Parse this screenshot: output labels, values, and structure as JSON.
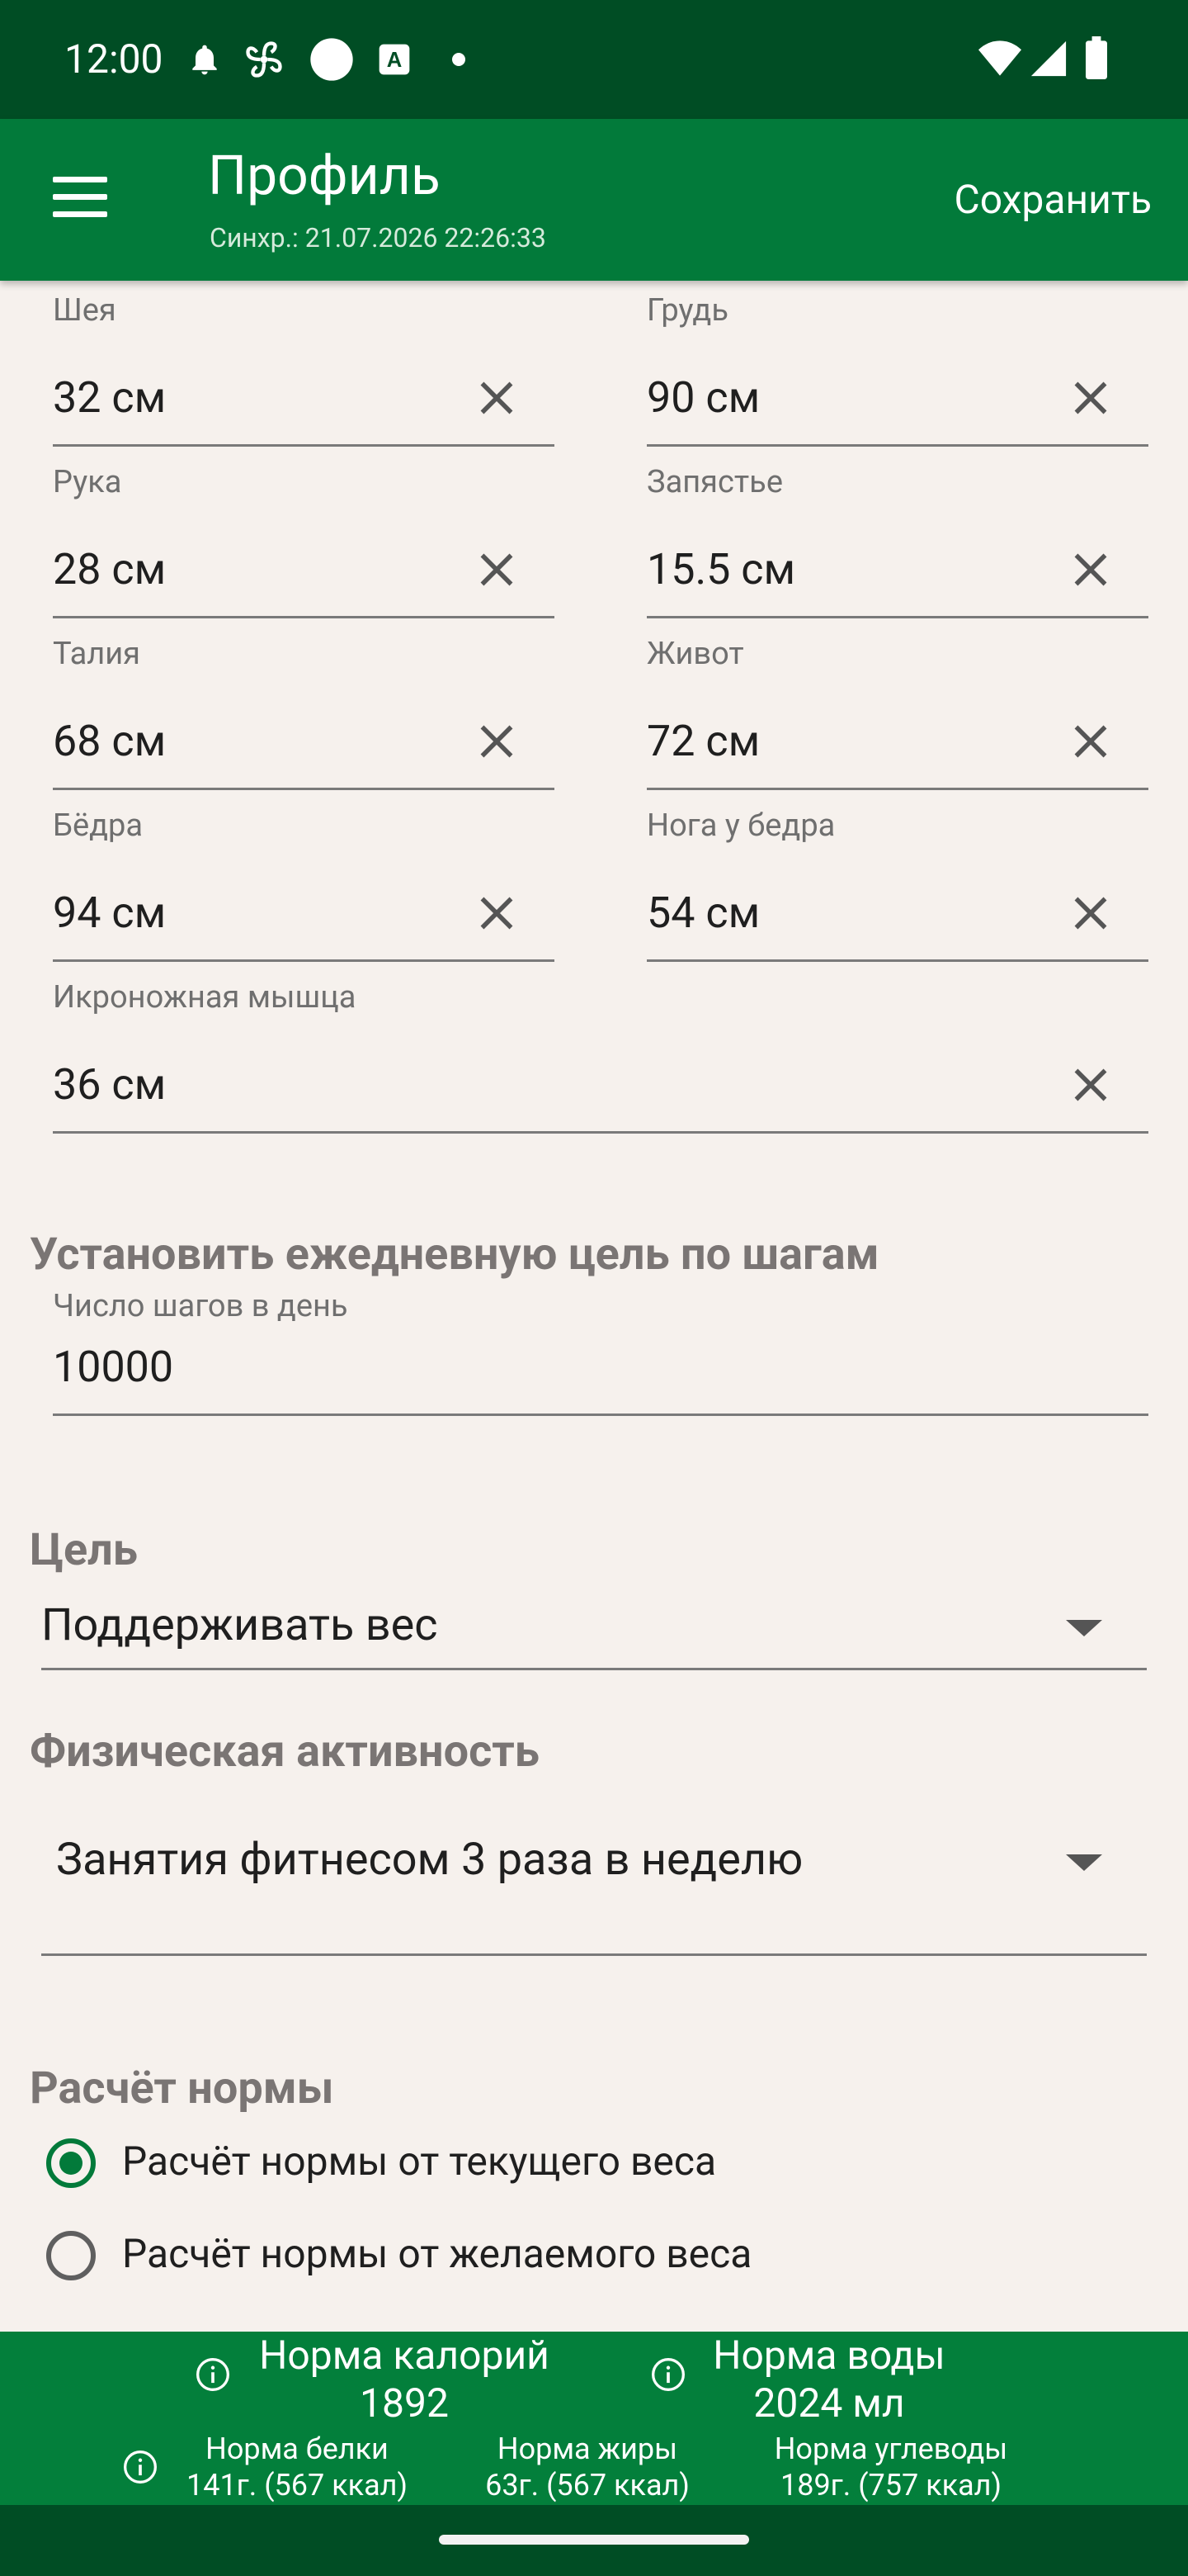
{
  "status_bar": {
    "time": "12:00",
    "icons": [
      "bell-icon",
      "fan-icon",
      "circle-icon",
      "a-box-icon",
      "dot-icon",
      "wifi-icon",
      "signal-icon",
      "battery-icon"
    ]
  },
  "app_bar": {
    "title": "Профиль",
    "subtitle": "Синхр.: 21.07.2026 22:26:33",
    "save_label": "Сохранить",
    "background_color": "#027a3a"
  },
  "measurements": [
    {
      "label": "Шея",
      "value": "32 см"
    },
    {
      "label": "Грудь",
      "value": "90 см"
    },
    {
      "label": "Рука",
      "value": "28 см"
    },
    {
      "label": "Запястье",
      "value": "15.5 см"
    },
    {
      "label": "Талия",
      "value": "68 см"
    },
    {
      "label": "Живот",
      "value": "72 см"
    },
    {
      "label": "Бёдра",
      "value": "94 см"
    },
    {
      "label": "Нога у бедра",
      "value": "54 см"
    },
    {
      "label": "Икроножная мышца",
      "value": "36 см"
    }
  ],
  "steps_goal": {
    "section_title": "Установить ежедневную цель по шагам",
    "field_label": "Число шагов в день",
    "value": "10000"
  },
  "goal": {
    "section_title": "Цель",
    "selected": "Поддерживать вес"
  },
  "activity": {
    "section_title": "Физическая активность",
    "selected": "Занятия фитнесом 3 раза в неделю"
  },
  "norm_calc": {
    "section_title": "Расчёт нормы",
    "options": [
      {
        "label": "Расчёт нормы от текущего веса",
        "selected": true
      },
      {
        "label": "Расчёт нормы от желаемого веса",
        "selected": false
      }
    ],
    "accent_color": "#027a3a"
  },
  "norms": {
    "calories_label": "Норма калорий",
    "calories_value": "1892",
    "water_label": "Норма воды",
    "water_value": "2024 мл",
    "protein_label": "Норма белки",
    "protein_value": "141г. (567 ккал)",
    "fat_label": "Норма жиры",
    "fat_value": "63г. (567 ккал)",
    "carbs_label": "Норма углеводы",
    "carbs_value": "189г. (757 ккал)",
    "background_color": "#037f3b"
  }
}
